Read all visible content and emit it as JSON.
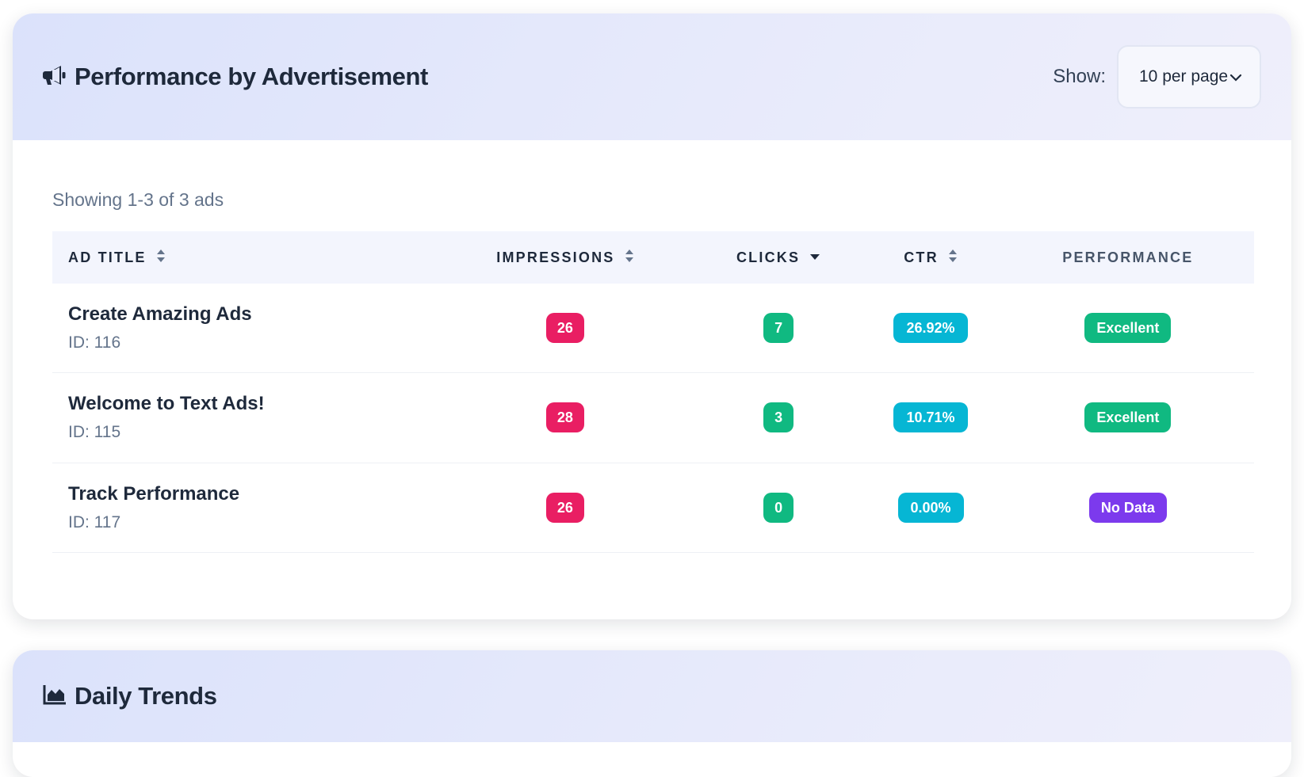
{
  "performance_card": {
    "title": "Performance by Advertisement",
    "title_icon": "megaphone-icon",
    "show_label": "Show:",
    "per_page_value": "10 per page",
    "showing_text": "Showing 1-3 of 3 ads",
    "columns": {
      "ad_title": "AD TITLE",
      "impressions": "IMPRESSIONS",
      "clicks": "CLICKS",
      "ctr": "CTR",
      "performance": "PERFORMANCE"
    },
    "rows": [
      {
        "title": "Create Amazing Ads",
        "id": "ID: 116",
        "impressions": "26",
        "clicks": "7",
        "ctr": "26.92%",
        "performance": "Excellent",
        "performance_color": "#10b981"
      },
      {
        "title": "Welcome to Text Ads!",
        "id": "ID: 115",
        "impressions": "28",
        "clicks": "3",
        "ctr": "10.71%",
        "performance": "Excellent",
        "performance_color": "#10b981"
      },
      {
        "title": "Track Performance",
        "id": "ID: 117",
        "impressions": "26",
        "clicks": "0",
        "ctr": "0.00%",
        "performance": "No Data",
        "performance_color": "#7c3aed"
      }
    ]
  },
  "trends_card": {
    "title": "Daily Trends",
    "title_icon": "area-chart-icon"
  },
  "colors": {
    "impressions_badge": "#e91e63",
    "clicks_badge": "#10b981",
    "ctr_badge": "#06b6d4",
    "excellent_badge": "#10b981",
    "no_data_badge": "#7c3aed"
  }
}
